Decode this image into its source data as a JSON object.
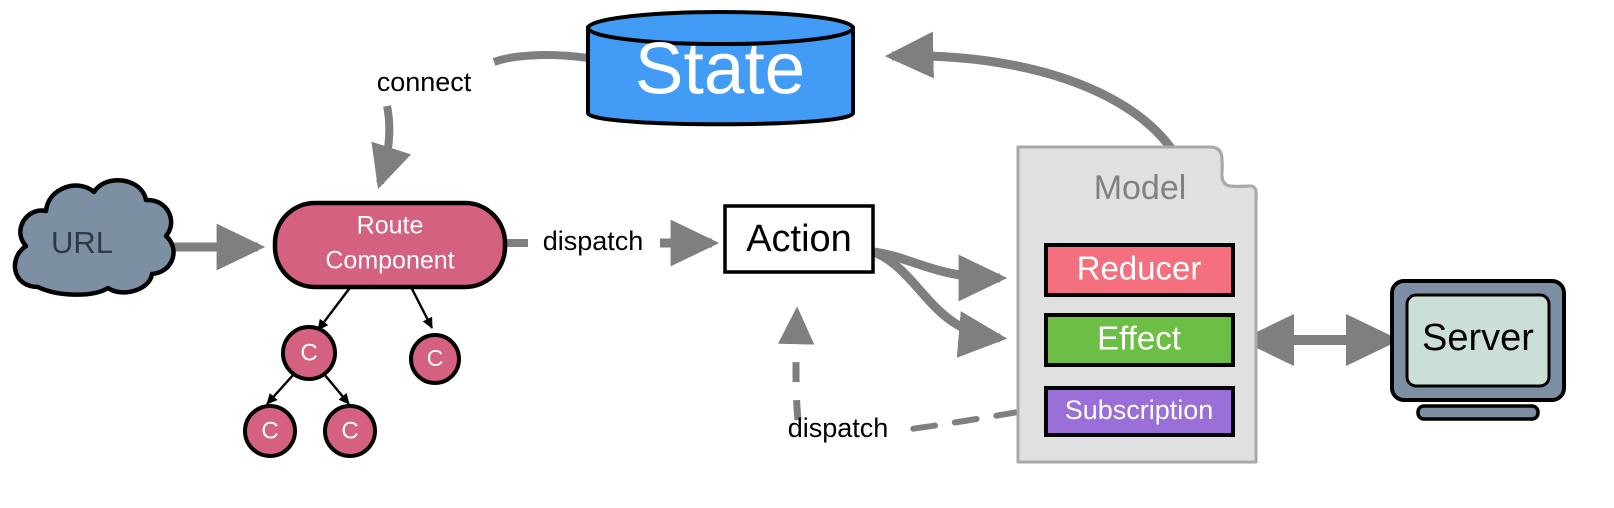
{
  "diagram": {
    "title": "Redux style application architecture flow",
    "background": "#ffffff"
  },
  "nodes": {
    "url": {
      "label": "URL",
      "shape": "cloud",
      "fill": "#7d8fa3",
      "stroke": "#000000",
      "text_color": "#2f3a45"
    },
    "route_component": {
      "label_line1": "Route",
      "label_line2": "Component",
      "shape": "rounded-rectangle",
      "fill": "#d4617f",
      "stroke": "#000000",
      "text_color": "#ffffff"
    },
    "state": {
      "label": "State",
      "shape": "cylinder",
      "fill": "#429bf4",
      "stroke": "#000000",
      "text_color": "#ffffff"
    },
    "action": {
      "label": "Action",
      "shape": "rectangle",
      "fill": "#ffffff",
      "stroke": "#000000",
      "text_color": "#000000"
    },
    "model": {
      "label": "Model",
      "shape": "note",
      "fill": "#e0e0e0",
      "stroke": "#a8a8a8",
      "text_color": "#808080"
    },
    "reducer": {
      "label": "Reducer",
      "shape": "rectangle",
      "fill": "#f4707e",
      "stroke": "#000000",
      "text_color": "#ffffff"
    },
    "effect": {
      "label": "Effect",
      "shape": "rectangle",
      "fill": "#6dbe45",
      "stroke": "#000000",
      "text_color": "#ffffff"
    },
    "subscription": {
      "label": "Subscription",
      "shape": "rectangle",
      "fill": "#9b6fd8",
      "stroke": "#000000",
      "text_color": "#ffffff"
    },
    "server": {
      "label": "Server",
      "shape": "monitor",
      "fill": "#ccdfd6",
      "bezel": "#7d8fa3",
      "stroke": "#000000",
      "text_color": "#000000"
    },
    "component_tree": {
      "label": "C",
      "fill": "#d4617f",
      "stroke": "#000000",
      "text_color": "#ffffff",
      "nodes": [
        {
          "id": "c1",
          "label": "C"
        },
        {
          "id": "c2",
          "label": "C"
        },
        {
          "id": "c3",
          "label": "C"
        },
        {
          "id": "c4",
          "label": "C"
        }
      ]
    }
  },
  "edges": [
    {
      "id": "url-to-route",
      "label": "",
      "from": "url",
      "to": "route_component",
      "style": "solid",
      "color": "#7f7f7f"
    },
    {
      "id": "state-to-route",
      "label": "connect",
      "from": "state",
      "to": "route_component",
      "style": "solid",
      "color": "#7f7f7f"
    },
    {
      "id": "route-to-action",
      "label": "dispatch",
      "from": "route_component",
      "to": "action",
      "style": "solid",
      "color": "#7f7f7f"
    },
    {
      "id": "action-to-reducer",
      "label": "",
      "from": "action",
      "to": "reducer",
      "style": "solid",
      "color": "#7f7f7f"
    },
    {
      "id": "action-to-effect",
      "label": "",
      "from": "action",
      "to": "effect",
      "style": "solid",
      "color": "#7f7f7f"
    },
    {
      "id": "model-to-state",
      "label": "",
      "from": "model",
      "to": "state",
      "style": "solid",
      "color": "#7f7f7f"
    },
    {
      "id": "effect-to-server",
      "label": "",
      "from": "effect",
      "to": "server",
      "style": "solid-bidirectional",
      "color": "#7f7f7f"
    },
    {
      "id": "subscription-to-action",
      "label": "dispatch",
      "from": "subscription",
      "to": "action",
      "style": "dashed",
      "color": "#7f7f7f"
    },
    {
      "id": "route-to-c1",
      "label": "",
      "from": "route_component",
      "to": "c1",
      "style": "thin",
      "color": "#000000"
    },
    {
      "id": "route-to-c2",
      "label": "",
      "from": "route_component",
      "to": "c2",
      "style": "thin",
      "color": "#000000"
    },
    {
      "id": "c1-to-c3",
      "label": "",
      "from": "c1",
      "to": "c3",
      "style": "thin",
      "color": "#000000"
    },
    {
      "id": "c1-to-c4",
      "label": "",
      "from": "c1",
      "to": "c4",
      "style": "thin",
      "color": "#000000"
    }
  ],
  "labels": {
    "connect": "connect",
    "dispatch_route": "dispatch",
    "dispatch_subscription": "dispatch"
  }
}
